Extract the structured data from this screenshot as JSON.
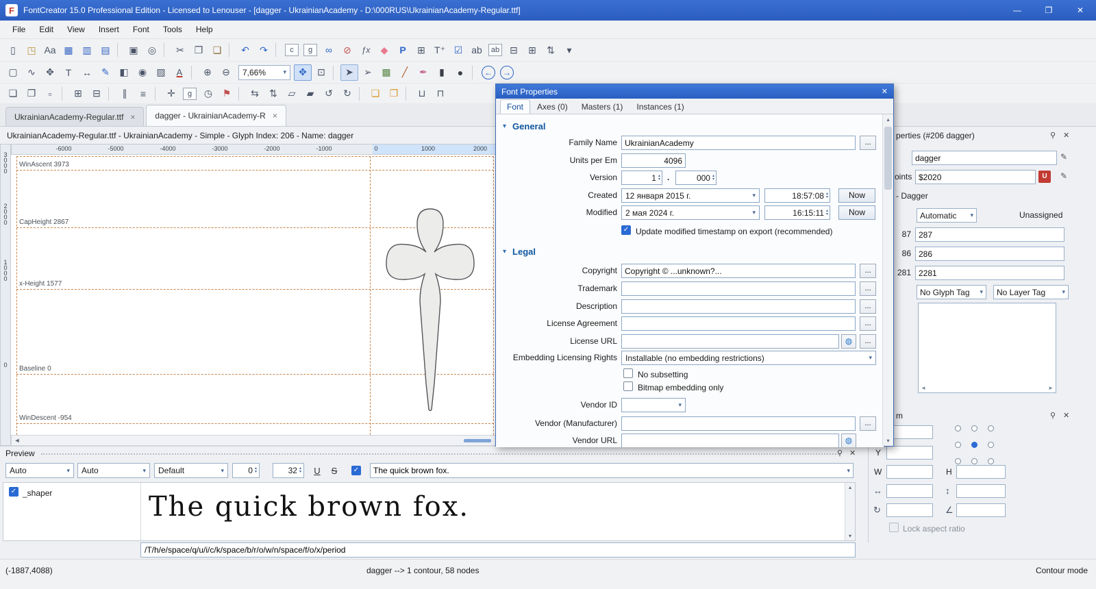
{
  "window": {
    "title": "FontCreator 15.0 Professional Edition - Licensed to Lenouser - [dagger - UkrainianAcademy - D:\\000RUS\\UkrainianAcademy-Regular.ttf]",
    "controls": {
      "minimize": "—",
      "maximize": "❐",
      "close": "✕"
    },
    "logo": "F"
  },
  "icons": {
    "close": "✕",
    "close_small": "×",
    "pin": "⚲",
    "dots": "...",
    "up": "▴",
    "down": "▾",
    "left": "◂",
    "right": "▸",
    "left_page": "◄",
    "right_page": "►",
    "globe": "◍",
    "check": "✓",
    "scale_h": "↔",
    "scale_v": "↕",
    "rotate": "↻",
    "skew": "∠",
    "unicode_badge": "U",
    "pencil": "✎"
  },
  "menu": {
    "items": [
      "File",
      "Edit",
      "View",
      "Insert",
      "Font",
      "Tools",
      "Help"
    ]
  },
  "toolbars": {
    "standard": [
      {
        "name": "new-document-icon",
        "glyph": "▯"
      },
      {
        "name": "open-file-icon",
        "glyph": "◳",
        "color": "#b8913d"
      },
      {
        "name": "font-overview-icon",
        "glyph": "Aa"
      },
      {
        "name": "save-icon",
        "glyph": "▦",
        "color": "#3565c2"
      },
      {
        "name": "save-as-icon",
        "glyph": "▥",
        "color": "#3565c2"
      },
      {
        "name": "save-all-icon",
        "glyph": "▤",
        "color": "#3565c2"
      },
      {
        "name": "separator",
        "cls": "sep",
        "inter": "false"
      },
      {
        "name": "print-icon",
        "glyph": "▣"
      },
      {
        "name": "find-icon",
        "glyph": "◎"
      },
      {
        "name": "separator",
        "cls": "sep",
        "inter": "false"
      },
      {
        "name": "cut-icon",
        "glyph": "✂"
      },
      {
        "name": "copy-icon",
        "glyph": "❐"
      },
      {
        "name": "paste-icon",
        "glyph": "❑",
        "color": "#8a6d3b"
      },
      {
        "name": "separator",
        "cls": "sep",
        "inter": "false"
      },
      {
        "name": "undo-icon",
        "gly­ph": "↶",
        "glyph": "↶",
        "color": "#2e66c8"
      },
      {
        "name": "redo-icon",
        "glyph": "↷",
        "color": "#2e66c8"
      },
      {
        "name": "separator",
        "cls": "sep",
        "inter": "false"
      },
      {
        "name": "copy-composite-icon",
        "glyph": "c",
        "cls": "boxed"
      },
      {
        "name": "paste-glyph-icon",
        "glyph": "g",
        "cls": "boxed"
      },
      {
        "name": "complete-composites-icon",
        "glyph": "∞",
        "color": "#2e66c8"
      },
      {
        "name": "decompose-icon",
        "glyph": "⊘",
        "color": "#c0504d"
      },
      {
        "name": "formula-icon",
        "glyph": "ƒx",
        "cls": "italic"
      },
      {
        "name": "eraser-icon",
        "glyph": "◆",
        "color": "#e87a90"
      },
      {
        "name": "font-properties-icon",
        "glyph": "P",
        "color": "#2e66c8",
        "cls": "bold"
      },
      {
        "name": "opentype-designer-icon",
        "glyph": "⊞"
      },
      {
        "name": "insert-character-icon",
        "glyph": "T⁺"
      },
      {
        "name": "validate-icon",
        "glyph": "☑",
        "color": "#2e66c8"
      },
      {
        "name": "spellcheck-icon",
        "glyph": "ab"
      },
      {
        "name": "glyph-names-icon",
        "glyph": "ab",
        "cls": "boxed"
      },
      {
        "name": "remove-glyph-icon",
        "glyph": "⊟"
      },
      {
        "name": "add-glyph-icon",
        "glyph": "⊞"
      },
      {
        "name": "sort-icon",
        "glyph": "⇅"
      },
      {
        "name": "toolbar-overflow-icon",
        "glyph": "▾"
      }
    ],
    "drawing_left": [
      {
        "name": "rectangle-select-icon",
        "glyph": "▢"
      },
      {
        "name": "lasso-select-icon",
        "glyph": "∿"
      },
      {
        "name": "pan-hand-icon",
        "glyph": "✥"
      },
      {
        "name": "text-tool-icon",
        "glyph": "T"
      },
      {
        "name": "metrics-tool-icon",
        "glyph": "↔"
      },
      {
        "name": "draw-contour-icon",
        "glyph": "✎",
        "color": "#2e66c8"
      },
      {
        "name": "fill-tool-icon",
        "glyph": "◧"
      },
      {
        "name": "preview-tool-icon",
        "glyph": "◉"
      },
      {
        "name": "hatch-fill-icon",
        "glyph": "▨"
      },
      {
        "name": "font-color-icon",
        "glyph": "A",
        "cls": "underlined"
      },
      {
        "name": "separator",
        "cls": "sep",
        "inter": "false"
      },
      {
        "name": "zoom-in-icon",
        "glyph": "⊕"
      },
      {
        "name": "zoom-out-icon",
        "glyph": "⊖"
      }
    ],
    "zoom_value": "7,66%",
    "drawing_right": [
      {
        "name": "zoom-fit-icon",
        "glyph": "✥",
        "color": "#2e66c8",
        "cls": "active-tool"
      },
      {
        "name": "zoom-selection-icon",
        "glyph": "⊡"
      },
      {
        "name": "separator",
        "cls": "sep",
        "inter": "false"
      },
      {
        "name": "contour-select-icon",
        "glyph": "➤",
        "cls": "pressed"
      },
      {
        "name": "point-add-icon",
        "glyph": "➢"
      },
      {
        "name": "image-trace-icon",
        "glyph": "▩",
        "color": "#5a8a4a"
      },
      {
        "name": "slice-icon",
        "glyph": "╱",
        "color": "#b05a2a"
      },
      {
        "name": "brush-icon",
        "glyph": "✒",
        "color": "#c2628e"
      },
      {
        "name": "rectangle-draw-icon",
        "glyph": "▮",
        "color": "#3a3f46"
      },
      {
        "name": "ellipse-draw-icon",
        "glyph": "●",
        "color": "#3a3f46"
      },
      {
        "name": "separator",
        "cls": "sep",
        "inter": "false"
      },
      {
        "name": "nav-back-icon",
        "glyph": "←",
        "color": "#2e66c8",
        "cls": "circled"
      },
      {
        "name": "nav-forward-icon",
        "glyph": "→",
        "color": "#2e66c8",
        "cls": "circled"
      }
    ],
    "glyph_tools": [
      {
        "name": "copy-outline-icon",
        "glyph": "❏"
      },
      {
        "name": "paste-outline-icon",
        "glyph": "❐"
      },
      {
        "name": "clear-outline-icon",
        "glyph": "▫"
      },
      {
        "name": "separator",
        "cls": "sep",
        "inter": "false"
      },
      {
        "name": "group-icon",
        "glyph": "⊞"
      },
      {
        "name": "ungroup-icon",
        "glyph": "⊟"
      },
      {
        "name": "separator",
        "cls": "sep",
        "inter": "false"
      },
      {
        "name": "align-icon",
        "glyph": "∥"
      },
      {
        "name": "distribute-icon",
        "glyph": "≡"
      },
      {
        "name": "separator",
        "cls": "sep",
        "inter": "false"
      },
      {
        "name": "guides-icon",
        "glyph": "✛"
      },
      {
        "name": "grid-toggle-icon",
        "glyph": "g",
        "cls": "boxed"
      },
      {
        "name": "history-clock-icon",
        "glyph": "◷"
      },
      {
        "name": "anchor-flag-icon",
        "glyph": "⚑",
        "color": "#c0504d"
      },
      {
        "name": "separator",
        "cls": "sep",
        "inter": "false"
      },
      {
        "name": "flip-horizontal-icon",
        "glyph": "⇆"
      },
      {
        "name": "flip-vertical-icon",
        "glyph": "⇅"
      },
      {
        "name": "skew-horizontal-icon",
        "glyph": "▱"
      },
      {
        "name": "skew-vertical-icon",
        "glyph": "▰"
      },
      {
        "name": "rotate-ccw-icon",
        "glyph": "↺"
      },
      {
        "name": "rotate-cw-icon",
        "glyph": "↻"
      },
      {
        "name": "separator",
        "cls": "sep",
        "inter": "false"
      },
      {
        "name": "bring-forward-icon",
        "glyph": "❏",
        "color": "#d99a2b"
      },
      {
        "name": "send-backward-icon",
        "glyph": "❐",
        "color": "#d99a2b"
      },
      {
        "name": "separator",
        "cls": "sep",
        "inter": "false"
      },
      {
        "name": "union-icon",
        "glyph": "⊔"
      },
      {
        "name": "intersection-icon",
        "glyph": "⊓"
      }
    ]
  },
  "document_tabs": [
    {
      "label": "UkrainianAcademy-Regular.ttf"
    },
    {
      "label": "dagger - UkrainianAcademy-R",
      "cls": "active"
    }
  ],
  "infobar": {
    "text": "UkrainianAcademy-Regular.ttf - UkrainianAcademy - Simple - Glyph Index: 206 - Name: dagger"
  },
  "ruler": {
    "h_ticks": [
      "-6000",
      "-5000",
      "-4000",
      "-3000",
      "-2000",
      "-1000",
      "0",
      "1000",
      "2000"
    ],
    "v_ticks": [
      "3000",
      "2000",
      "1000",
      "0"
    ]
  },
  "canvas": {
    "metrics": [
      {
        "label": "WinAscent 3973"
      },
      {
        "label": "CapHeight 2867"
      },
      {
        "label": "x-Height 1577"
      },
      {
        "label": "Baseline 0"
      },
      {
        "label": "WinDescent -954"
      }
    ]
  },
  "dialog": {
    "title": "Font Properties",
    "tabs": [
      {
        "label": "Font",
        "cls": "active"
      },
      {
        "label": "Axes (0)"
      },
      {
        "label": "Masters (1)"
      },
      {
        "label": "Instances (1)"
      }
    ],
    "general": {
      "title": "General",
      "family_label": "Family Name",
      "family_value": "UkrainianAcademy",
      "upm_label": "Units per Em",
      "upm_value": "4096",
      "version_label": "Version",
      "version_major": "1",
      "version_dot": ".",
      "version_minor": "000",
      "created_label": "Created",
      "created_date": "12 января 2015 г.",
      "created_time": "18:57:08",
      "created_now": "Now",
      "modified_label": "Modified",
      "modified_date": "2 мая 2024 г.",
      "modified_time": "16:15:11",
      "modified_now": "Now",
      "update_checkbox_label": "Update modified timestamp on export (recommended)"
    },
    "legal": {
      "title": "Legal",
      "copyright_label": "Copyright",
      "copyright_value": "Copyright © ...unknown?...",
      "trademark_label": "Trademark",
      "description_label": "Description",
      "license_label": "License Agreement",
      "license_url_label": "License URL",
      "embedding_label": "Embedding Licensing Rights",
      "embedding_value": "Installable (no embedding restrictions)",
      "no_subsetting_label": "No subsetting",
      "bitmap_label": "Bitmap embedding only",
      "vendor_id_label": "Vendor ID",
      "vendor_label": "Vendor (Manufacturer)",
      "vendor_url_label": "Vendor URL"
    }
  },
  "right_panel": {
    "title_fragment": "perties (#206 dagger)",
    "glyph_name": "dagger",
    "codepoints_label_fragment": "oints",
    "codepoints_value": "$2020",
    "unicode_name_fragment": "- Dagger",
    "mapping_select": "Automatic",
    "mapping_status": "Unassigned",
    "metric_rows": [
      {
        "calc": "87",
        "value": "287"
      },
      {
        "calc": "86",
        "value": "286"
      },
      {
        "calc": "281",
        "value": "2281"
      }
    ],
    "glyph_tag_select": "No Glyph Tag",
    "layer_tag_select": "No Layer Tag"
  },
  "transform_panel": {
    "title_fragment": "m",
    "y_label": "Y",
    "w_label": "W",
    "h_label": "H",
    "lock_label": "Lock aspect ratio"
  },
  "preview": {
    "title": "Preview",
    "script_select": "Auto",
    "language_select": "Auto",
    "features_select": "Default",
    "tracking_value": "0",
    "size_value": "32",
    "underline_label": "U",
    "strike_label": "S",
    "sample_text": "The quick brown fox.",
    "shaper_label": "_shaper",
    "preview_text": "The quick brown fox.",
    "glyph_sequence": "/T/h/e/space/q/u/i/c/k/space/b/r/o/w/n/space/f/o/x/period"
  },
  "statusbar": {
    "coords": "(-1887,4088)",
    "glyph_info": "dagger -->   1 contour, 58 nodes",
    "mode": "Contour mode"
  }
}
